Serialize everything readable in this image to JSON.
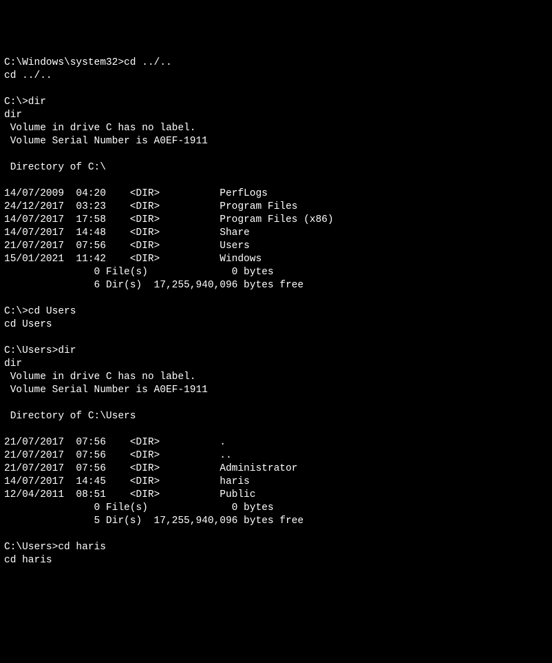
{
  "lines": [
    {
      "kind": "prompt",
      "prompt": "C:\\Windows\\system32>",
      "cmd": "cd ../.."
    },
    {
      "kind": "text",
      "text": "cd ../.."
    },
    {
      "kind": "blank"
    },
    {
      "kind": "prompt",
      "prompt": "C:\\>",
      "cmd": "dir"
    },
    {
      "kind": "text",
      "text": "dir"
    },
    {
      "kind": "text",
      "text": " Volume in drive C has no label."
    },
    {
      "kind": "text",
      "text": " Volume Serial Number is A0EF-1911"
    },
    {
      "kind": "blank"
    },
    {
      "kind": "text",
      "text": " Directory of C:\\"
    },
    {
      "kind": "blank"
    },
    {
      "kind": "entry",
      "date": "14/07/2009",
      "time": "04:20",
      "type": "<DIR>",
      "size": "",
      "name": "PerfLogs"
    },
    {
      "kind": "entry",
      "date": "24/12/2017",
      "time": "03:23",
      "type": "<DIR>",
      "size": "",
      "name": "Program Files"
    },
    {
      "kind": "entry",
      "date": "14/07/2017",
      "time": "17:58",
      "type": "<DIR>",
      "size": "",
      "name": "Program Files (x86)"
    },
    {
      "kind": "entry",
      "date": "14/07/2017",
      "time": "14:48",
      "type": "<DIR>",
      "size": "",
      "name": "Share"
    },
    {
      "kind": "entry",
      "date": "21/07/2017",
      "time": "07:56",
      "type": "<DIR>",
      "size": "",
      "name": "Users"
    },
    {
      "kind": "entry",
      "date": "15/01/2021",
      "time": "11:42",
      "type": "<DIR>",
      "size": "",
      "name": "Windows"
    },
    {
      "kind": "summary",
      "files": "0",
      "files_label": "File(s)",
      "bytes": "0",
      "bytes_label": "bytes"
    },
    {
      "kind": "summary2",
      "dirs": "6",
      "dirs_label": "Dir(s)",
      "free": "17,255,940,096",
      "free_label": "bytes free"
    },
    {
      "kind": "blank"
    },
    {
      "kind": "prompt",
      "prompt": "C:\\>",
      "cmd": "cd Users"
    },
    {
      "kind": "text",
      "text": "cd Users"
    },
    {
      "kind": "blank"
    },
    {
      "kind": "prompt",
      "prompt": "C:\\Users>",
      "cmd": "dir"
    },
    {
      "kind": "text",
      "text": "dir"
    },
    {
      "kind": "text",
      "text": " Volume in drive C has no label."
    },
    {
      "kind": "text",
      "text": " Volume Serial Number is A0EF-1911"
    },
    {
      "kind": "blank"
    },
    {
      "kind": "text",
      "text": " Directory of C:\\Users"
    },
    {
      "kind": "blank"
    },
    {
      "kind": "entry",
      "date": "21/07/2017",
      "time": "07:56",
      "type": "<DIR>",
      "size": "",
      "name": "."
    },
    {
      "kind": "entry",
      "date": "21/07/2017",
      "time": "07:56",
      "type": "<DIR>",
      "size": "",
      "name": ".."
    },
    {
      "kind": "entry",
      "date": "21/07/2017",
      "time": "07:56",
      "type": "<DIR>",
      "size": "",
      "name": "Administrator"
    },
    {
      "kind": "entry",
      "date": "14/07/2017",
      "time": "14:45",
      "type": "<DIR>",
      "size": "",
      "name": "haris"
    },
    {
      "kind": "entry",
      "date": "12/04/2011",
      "time": "08:51",
      "type": "<DIR>",
      "size": "",
      "name": "Public"
    },
    {
      "kind": "summary",
      "files": "0",
      "files_label": "File(s)",
      "bytes": "0",
      "bytes_label": "bytes"
    },
    {
      "kind": "summary2",
      "dirs": "5",
      "dirs_label": "Dir(s)",
      "free": "17,255,940,096",
      "free_label": "bytes free"
    },
    {
      "kind": "blank"
    },
    {
      "kind": "prompt",
      "prompt": "C:\\Users>",
      "cmd": "cd haris"
    },
    {
      "kind": "text",
      "text": "cd haris"
    }
  ]
}
